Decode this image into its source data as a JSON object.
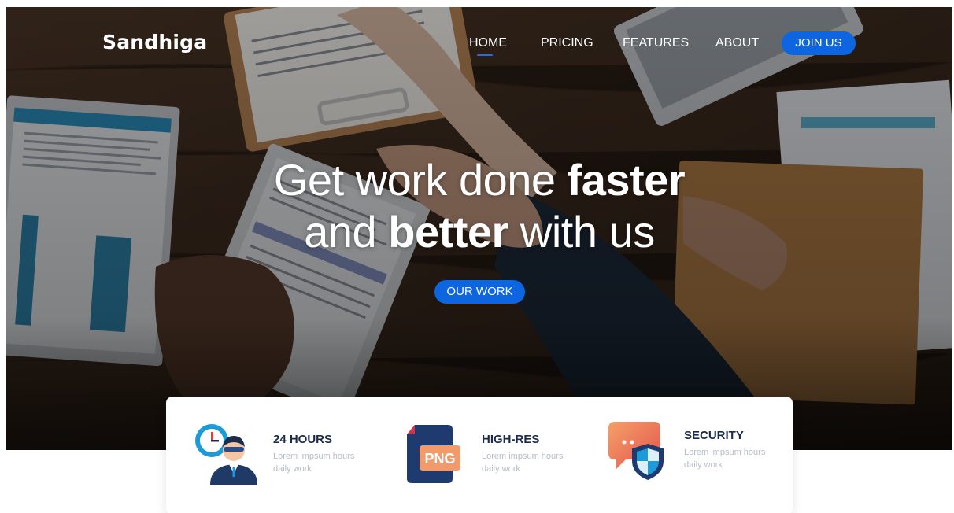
{
  "brand": {
    "name": "Sandhiga",
    "accent_color": "#0d66e0"
  },
  "nav": {
    "items": [
      {
        "label": "HOME",
        "active": true
      },
      {
        "label": "PRICING",
        "active": false
      },
      {
        "label": "FEATURES",
        "active": false
      },
      {
        "label": "ABOUT",
        "active": false
      }
    ],
    "cta_label": "JOIN US"
  },
  "hero": {
    "headline_line1_light": "Get work done ",
    "headline_line1_bold": "faster",
    "headline_line2_light_a": "and ",
    "headline_line2_bold": "better",
    "headline_line2_light_b": " with us",
    "cta_label": "OUR WORK",
    "background_image": "business-handshake-over-desk-with-documents"
  },
  "features": [
    {
      "title": "24 HOURS",
      "desc_line1": "Lorem impsum hours",
      "desc_line2": "daily work",
      "icon": "support-agent-clock-icon"
    },
    {
      "title": "HIGH-RES",
      "desc_line1": "Lorem impsum hours",
      "desc_line2": "daily work",
      "icon": "png-file-icon",
      "icon_text": "PNG"
    },
    {
      "title": "SECURITY",
      "desc_line1": "Lorem impsum hours",
      "desc_line2": "daily work",
      "icon": "chat-shield-icon"
    }
  ]
}
